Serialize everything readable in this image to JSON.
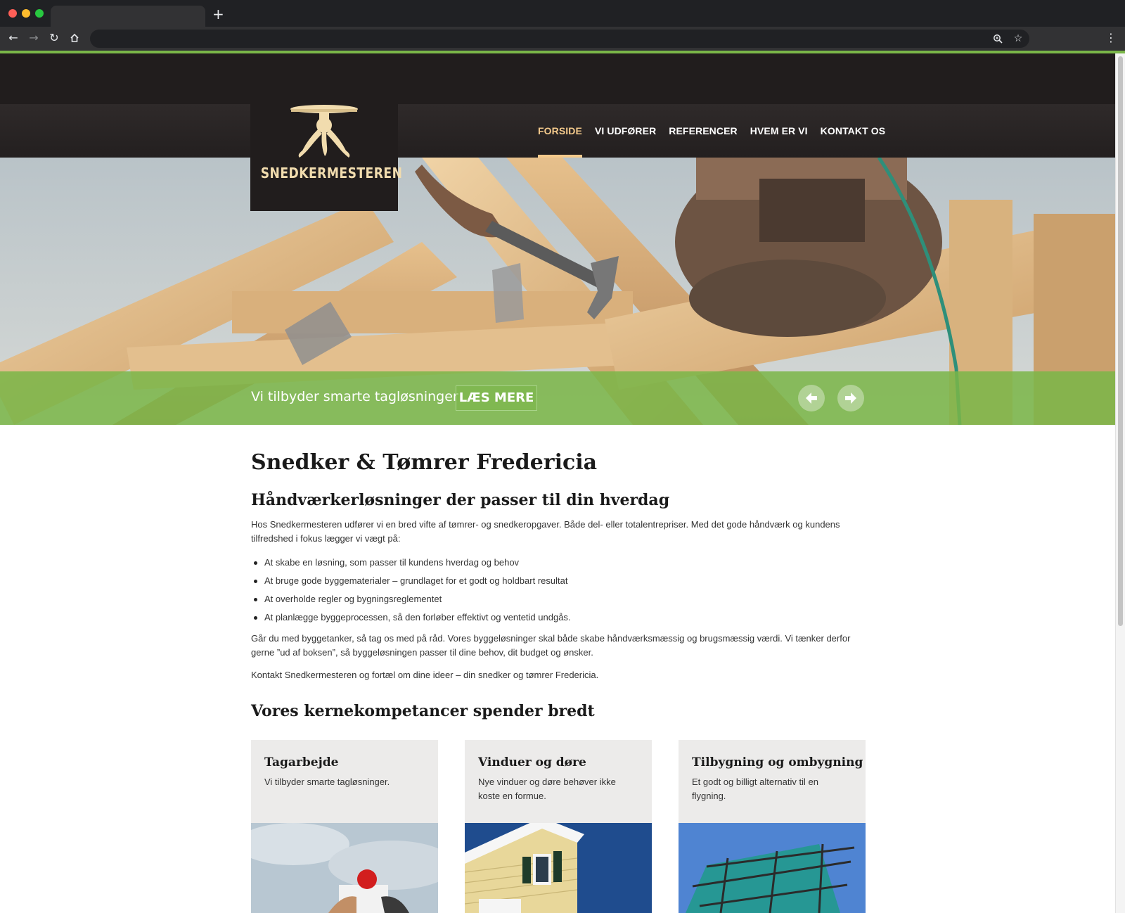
{
  "browser": {
    "new_tab_symbol": "+",
    "back_icon": "arrow-left-icon",
    "forward_icon": "arrow-right-icon",
    "reload_icon": "reload-icon",
    "home_icon": "home-icon",
    "zoom_icon": "zoom-icon",
    "bookmark_icon": "star-icon",
    "menu_icon": "kebab-menu-icon",
    "accent_color": "#7ab648"
  },
  "site": {
    "logo_text": "SNEDKERMESTEREN",
    "nav": [
      {
        "label": "FORSIDE",
        "active": true
      },
      {
        "label": "VI UDFØRER",
        "active": false
      },
      {
        "label": "REFERENCER",
        "active": false
      },
      {
        "label": "HVEM ER VI",
        "active": false
      },
      {
        "label": "KONTAKT OS",
        "active": false
      }
    ],
    "colors": {
      "header_bg": "#211d1d",
      "nav_active": "#f3c98b",
      "logo_gold": "#f1dcae",
      "green": "#7ab648"
    }
  },
  "hero": {
    "caption": "Vi tilbyder smarte tagløsninger",
    "button": "LÆS MERE",
    "prev_icon": "arrow-left-circle-icon",
    "next_icon": "arrow-right-circle-icon"
  },
  "content": {
    "title": "Snedker & Tømrer Fredericia",
    "subtitle": "Håndværkerløsninger der passer til din hverdag",
    "intro": "Hos Snedkermesteren udfører vi en bred vifte af tømrer- og snedkeropgaver. Både del- eller totalentrepriser. Med det gode håndværk og kundens tilfredshed i fokus lægger vi vægt på:",
    "bullets": [
      "At skabe en løsning, som passer til kundens hverdag og behov",
      "At bruge gode byggematerialer – grundlaget for et godt og holdbart resultat",
      "At overholde regler og bygningsreglementet",
      "At planlægge byggeprocessen, så den forløber effektivt og ventetid undgås."
    ],
    "paragraph2": "Går du med byggetanker, så tag os med på råd. Vores byggeløsninger skal både skabe håndværksmæssig og brugsmæssig værdi. Vi tænker derfor gerne ”ud af boksen”, så byggeløsningen passer til dine behov, dit budget og ønsker.",
    "paragraph3": "Kontakt Snedkermesteren og fortæl om dine ideer – din snedker og tømrer Fredericia.",
    "section_title": "Vores kernekompetancer spender bredt"
  },
  "cards": [
    {
      "title": "Tagarbejde",
      "text": "Vi tilbyder smarte tagløsninger."
    },
    {
      "title": "Vinduer og døre",
      "text": "Nye vinduer og døre behøver ikke koste en formue."
    },
    {
      "title": "Tilbygning og ombygning",
      "text": "Et godt og billigt alternativ til en flygning."
    }
  ]
}
